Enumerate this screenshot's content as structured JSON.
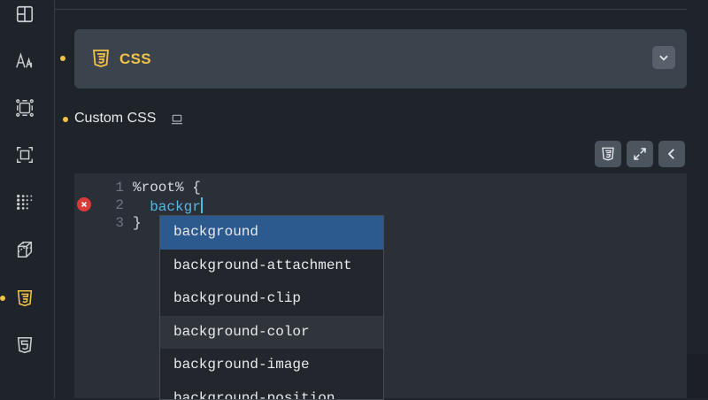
{
  "sidebar": {
    "items": [
      {
        "name": "layout",
        "icon": "layout-icon"
      },
      {
        "name": "typography",
        "icon": "typography-icon"
      },
      {
        "name": "spacing",
        "icon": "spacing-icon"
      },
      {
        "name": "size",
        "icon": "size-icon"
      },
      {
        "name": "grid",
        "icon": "dots-grid-icon"
      },
      {
        "name": "transform",
        "icon": "cube-icon"
      },
      {
        "name": "css",
        "icon": "css3-icon",
        "active": true
      },
      {
        "name": "html",
        "icon": "html5-icon"
      }
    ]
  },
  "panel": {
    "title": "CSS",
    "icon": "css3-icon",
    "accent": "#f0c349"
  },
  "custom_css": {
    "label": "Custom CSS"
  },
  "toolbar": {
    "buttons": [
      "css3-icon",
      "expand-icon",
      "chevron-left-icon"
    ]
  },
  "editor": {
    "lines": [
      {
        "number": "1",
        "code": "%root% {"
      },
      {
        "number": "2",
        "code": "  backgr"
      },
      {
        "number": "3",
        "code": "}"
      }
    ]
  },
  "autocomplete": {
    "items": [
      "background",
      "background-attachment",
      "background-clip",
      "background-color",
      "background-image",
      "background-position"
    ],
    "selected": "background",
    "hovered": "background-color"
  }
}
